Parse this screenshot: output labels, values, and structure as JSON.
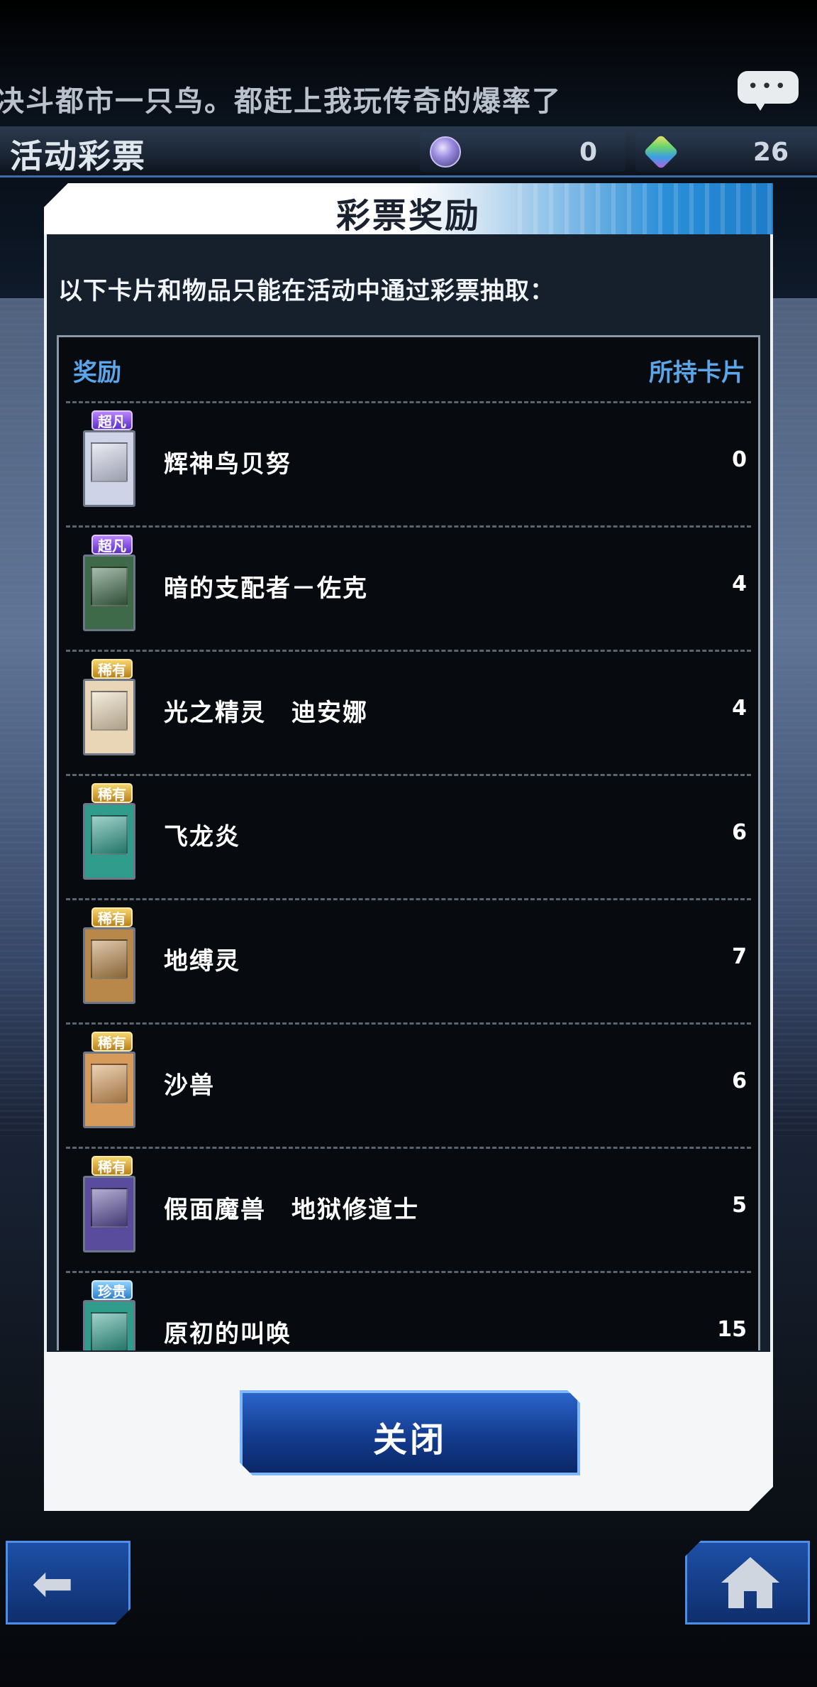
{
  "ticker": {
    "text": "决斗都市一只鸟。都赶上我玩传奇的爆率了"
  },
  "header": {
    "title": "活动彩票",
    "currency_1": {
      "icon": "orb-coin-icon",
      "value": "0"
    },
    "currency_2": {
      "icon": "gem-icon",
      "value": "26"
    }
  },
  "dialog": {
    "title": "彩票奖励",
    "subtitle": "以下卡片和物品只能在活动中通过彩票抽取：",
    "col_reward": "奖励",
    "col_owned": "所持卡片",
    "close_label": "关闭",
    "rows": [
      {
        "rarity": "超凡",
        "rarity_class": "ur",
        "name": "辉神鸟贝努",
        "count": "0",
        "card_color": "#cfd3e8"
      },
      {
        "rarity": "超凡",
        "rarity_class": "ur",
        "name": "暗的支配者－佐克",
        "count": "4",
        "card_color": "#3e6a4a"
      },
      {
        "rarity": "稀有",
        "rarity_class": "sr",
        "name": "光之精灵　迪安娜",
        "count": "4",
        "card_color": "#e8d6b6"
      },
      {
        "rarity": "稀有",
        "rarity_class": "sr",
        "name": "飞龙炎",
        "count": "6",
        "card_color": "#2f9c8c"
      },
      {
        "rarity": "稀有",
        "rarity_class": "sr",
        "name": "地缚灵",
        "count": "7",
        "card_color": "#b8874a"
      },
      {
        "rarity": "稀有",
        "rarity_class": "sr",
        "name": "沙兽",
        "count": "6",
        "card_color": "#d69a5a"
      },
      {
        "rarity": "稀有",
        "rarity_class": "sr",
        "name": "假面魔兽　地狱修道士",
        "count": "5",
        "card_color": "#5a4c9c"
      },
      {
        "rarity": "珍贵",
        "rarity_class": "r",
        "name": "原初的叫唤",
        "count": "15",
        "card_color": "#2f9c8c"
      }
    ]
  },
  "nav": {
    "back_icon": "arrow-left-icon",
    "home_icon": "home-icon"
  }
}
